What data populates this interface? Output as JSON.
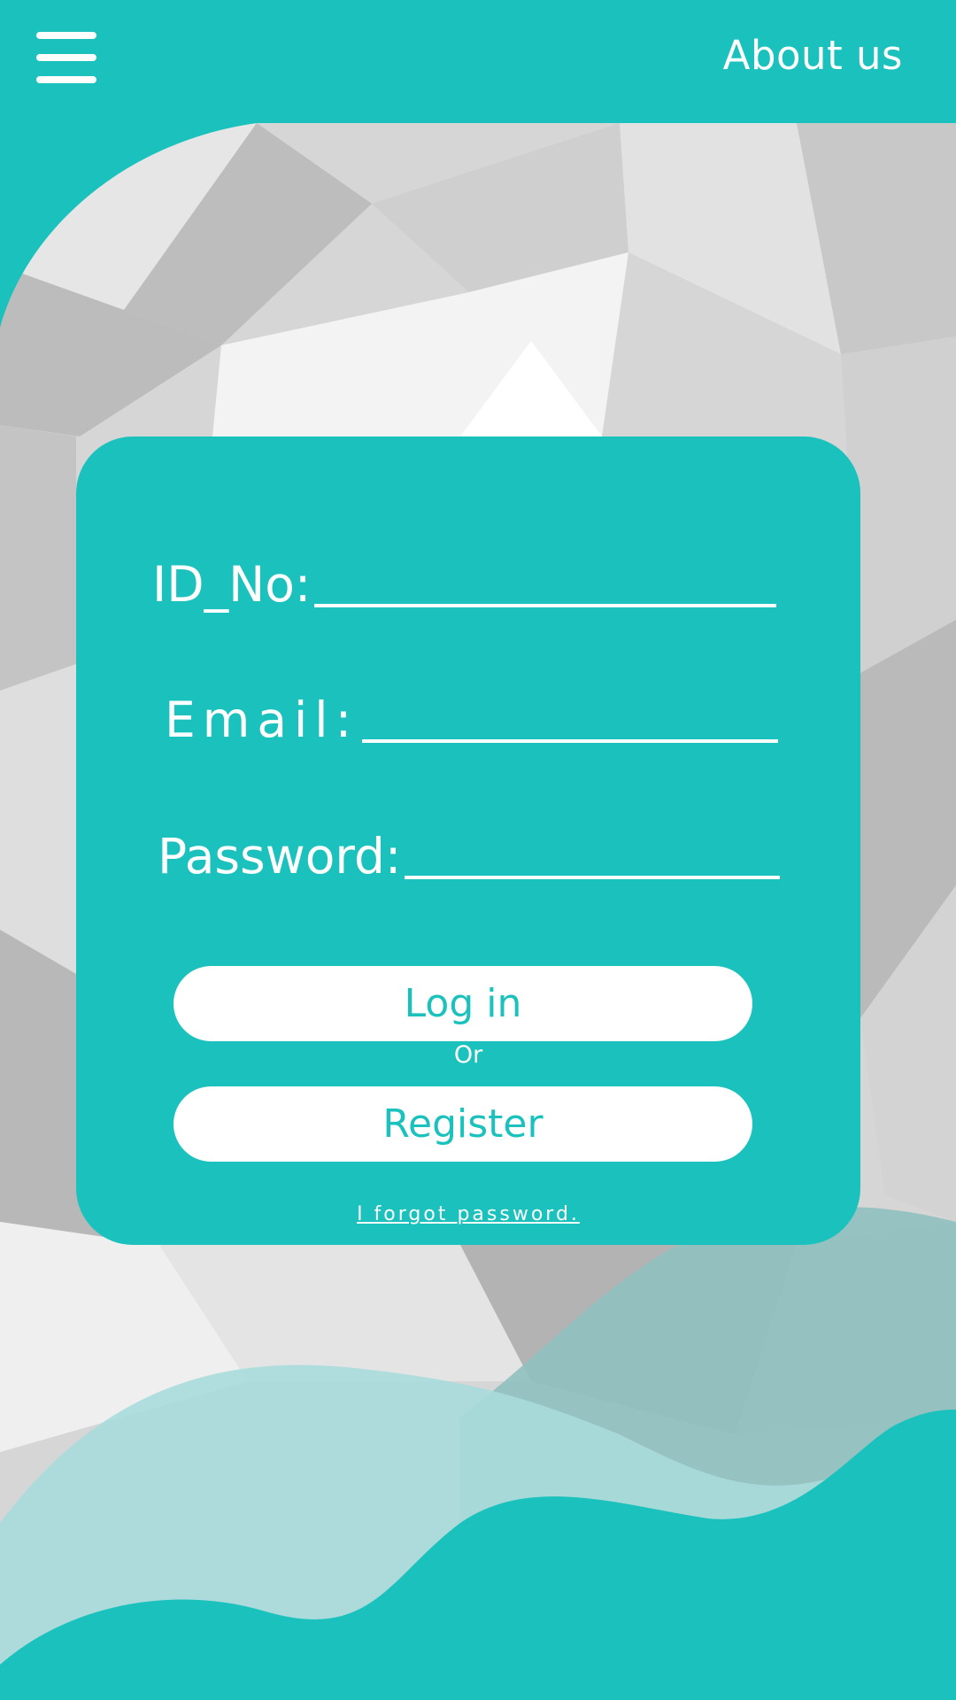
{
  "header": {
    "menu_icon": "hamburger-menu-icon",
    "about_label": "About us"
  },
  "form": {
    "id_label": "ID_No:",
    "email_label": "Email:",
    "password_label": "Password:",
    "login_label": "Log in",
    "or_label": "Or",
    "register_label": "Register",
    "forgot_label": "I forgot password."
  },
  "colors": {
    "accent": "#1bc2bd",
    "text_on_accent": "#ffffff",
    "wave_light": "#a8dcdb",
    "wave_mid": "#8fc0bf"
  }
}
